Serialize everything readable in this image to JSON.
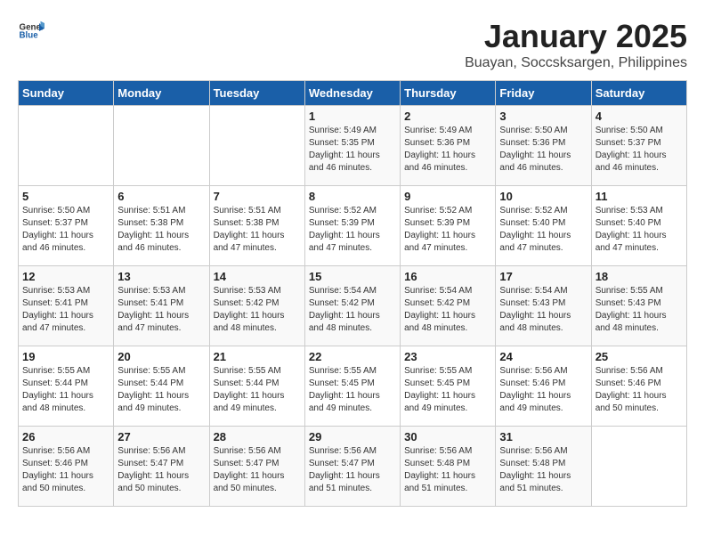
{
  "logo": {
    "general": "General",
    "blue": "Blue"
  },
  "title": "January 2025",
  "subtitle": "Buayan, Soccsksargen, Philippines",
  "days_of_week": [
    "Sunday",
    "Monday",
    "Tuesday",
    "Wednesday",
    "Thursday",
    "Friday",
    "Saturday"
  ],
  "weeks": [
    [
      {
        "day": "",
        "info": ""
      },
      {
        "day": "",
        "info": ""
      },
      {
        "day": "",
        "info": ""
      },
      {
        "day": "1",
        "info": "Sunrise: 5:49 AM\nSunset: 5:35 PM\nDaylight: 11 hours and 46 minutes."
      },
      {
        "day": "2",
        "info": "Sunrise: 5:49 AM\nSunset: 5:36 PM\nDaylight: 11 hours and 46 minutes."
      },
      {
        "day": "3",
        "info": "Sunrise: 5:50 AM\nSunset: 5:36 PM\nDaylight: 11 hours and 46 minutes."
      },
      {
        "day": "4",
        "info": "Sunrise: 5:50 AM\nSunset: 5:37 PM\nDaylight: 11 hours and 46 minutes."
      }
    ],
    [
      {
        "day": "5",
        "info": "Sunrise: 5:50 AM\nSunset: 5:37 PM\nDaylight: 11 hours and 46 minutes."
      },
      {
        "day": "6",
        "info": "Sunrise: 5:51 AM\nSunset: 5:38 PM\nDaylight: 11 hours and 46 minutes."
      },
      {
        "day": "7",
        "info": "Sunrise: 5:51 AM\nSunset: 5:38 PM\nDaylight: 11 hours and 47 minutes."
      },
      {
        "day": "8",
        "info": "Sunrise: 5:52 AM\nSunset: 5:39 PM\nDaylight: 11 hours and 47 minutes."
      },
      {
        "day": "9",
        "info": "Sunrise: 5:52 AM\nSunset: 5:39 PM\nDaylight: 11 hours and 47 minutes."
      },
      {
        "day": "10",
        "info": "Sunrise: 5:52 AM\nSunset: 5:40 PM\nDaylight: 11 hours and 47 minutes."
      },
      {
        "day": "11",
        "info": "Sunrise: 5:53 AM\nSunset: 5:40 PM\nDaylight: 11 hours and 47 minutes."
      }
    ],
    [
      {
        "day": "12",
        "info": "Sunrise: 5:53 AM\nSunset: 5:41 PM\nDaylight: 11 hours and 47 minutes."
      },
      {
        "day": "13",
        "info": "Sunrise: 5:53 AM\nSunset: 5:41 PM\nDaylight: 11 hours and 47 minutes."
      },
      {
        "day": "14",
        "info": "Sunrise: 5:53 AM\nSunset: 5:42 PM\nDaylight: 11 hours and 48 minutes."
      },
      {
        "day": "15",
        "info": "Sunrise: 5:54 AM\nSunset: 5:42 PM\nDaylight: 11 hours and 48 minutes."
      },
      {
        "day": "16",
        "info": "Sunrise: 5:54 AM\nSunset: 5:42 PM\nDaylight: 11 hours and 48 minutes."
      },
      {
        "day": "17",
        "info": "Sunrise: 5:54 AM\nSunset: 5:43 PM\nDaylight: 11 hours and 48 minutes."
      },
      {
        "day": "18",
        "info": "Sunrise: 5:55 AM\nSunset: 5:43 PM\nDaylight: 11 hours and 48 minutes."
      }
    ],
    [
      {
        "day": "19",
        "info": "Sunrise: 5:55 AM\nSunset: 5:44 PM\nDaylight: 11 hours and 48 minutes."
      },
      {
        "day": "20",
        "info": "Sunrise: 5:55 AM\nSunset: 5:44 PM\nDaylight: 11 hours and 49 minutes."
      },
      {
        "day": "21",
        "info": "Sunrise: 5:55 AM\nSunset: 5:44 PM\nDaylight: 11 hours and 49 minutes."
      },
      {
        "day": "22",
        "info": "Sunrise: 5:55 AM\nSunset: 5:45 PM\nDaylight: 11 hours and 49 minutes."
      },
      {
        "day": "23",
        "info": "Sunrise: 5:55 AM\nSunset: 5:45 PM\nDaylight: 11 hours and 49 minutes."
      },
      {
        "day": "24",
        "info": "Sunrise: 5:56 AM\nSunset: 5:46 PM\nDaylight: 11 hours and 49 minutes."
      },
      {
        "day": "25",
        "info": "Sunrise: 5:56 AM\nSunset: 5:46 PM\nDaylight: 11 hours and 50 minutes."
      }
    ],
    [
      {
        "day": "26",
        "info": "Sunrise: 5:56 AM\nSunset: 5:46 PM\nDaylight: 11 hours and 50 minutes."
      },
      {
        "day": "27",
        "info": "Sunrise: 5:56 AM\nSunset: 5:47 PM\nDaylight: 11 hours and 50 minutes."
      },
      {
        "day": "28",
        "info": "Sunrise: 5:56 AM\nSunset: 5:47 PM\nDaylight: 11 hours and 50 minutes."
      },
      {
        "day": "29",
        "info": "Sunrise: 5:56 AM\nSunset: 5:47 PM\nDaylight: 11 hours and 51 minutes."
      },
      {
        "day": "30",
        "info": "Sunrise: 5:56 AM\nSunset: 5:48 PM\nDaylight: 11 hours and 51 minutes."
      },
      {
        "day": "31",
        "info": "Sunrise: 5:56 AM\nSunset: 5:48 PM\nDaylight: 11 hours and 51 minutes."
      },
      {
        "day": "",
        "info": ""
      }
    ]
  ]
}
